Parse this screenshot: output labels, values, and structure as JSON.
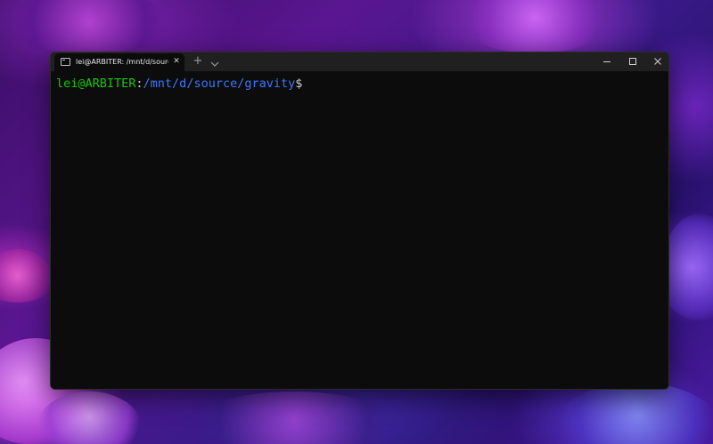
{
  "window": {
    "tab_title": "lei@ARBITER: /mnt/d/source/gr",
    "tab_close_glyph": "✕",
    "new_tab_glyph": "+"
  },
  "terminal": {
    "user_host": "lei@ARBITER",
    "separator": ":",
    "cwd": "/mnt/d/source/gravity",
    "prompt_symbol": "$"
  },
  "colors": {
    "prompt_user": "#16c60c",
    "prompt_path": "#3b78ff",
    "terminal_bg": "#0c0c0c",
    "titlebar_bg": "#202020"
  },
  "icons": {
    "tab": "terminal-icon",
    "close_tab": "close-icon",
    "new_tab": "plus-icon",
    "dropdown": "chevron-down-icon",
    "minimize": "minimize-icon",
    "maximize": "maximize-icon",
    "close_window": "close-icon"
  }
}
